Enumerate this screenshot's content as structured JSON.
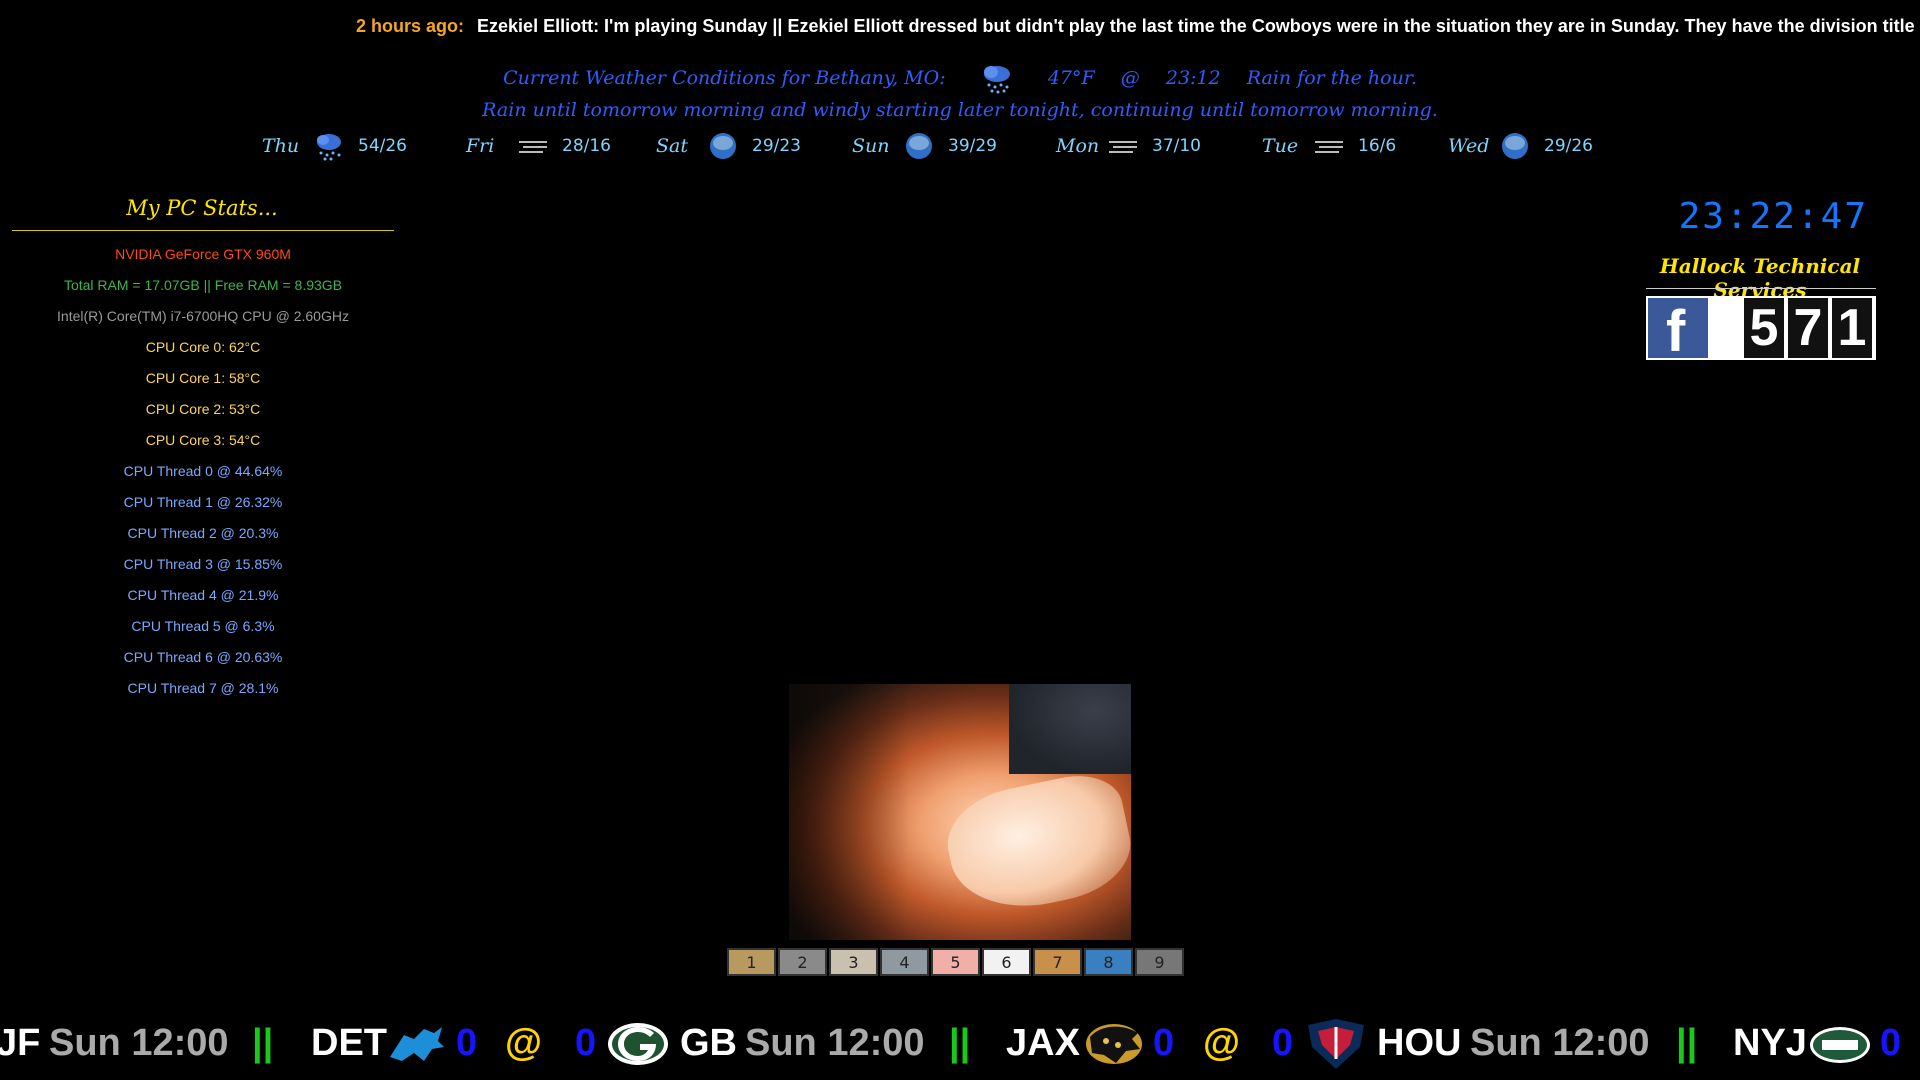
{
  "news": {
    "time": "2 hours ago:",
    "text": "Ezekiel Elliott: I'm playing Sunday  ||  Ezekiel Elliott dressed but didn't play the last time the Cowboys were in the situation they are in Sunday. They have the division title clinched and are locked i"
  },
  "weather": {
    "label": "Current Weather Conditions for Bethany, MO:",
    "temp": "47°F",
    "at": "@",
    "time": "23:12",
    "summary_hour": "Rain for the hour.",
    "summary_long": "Rain until tomorrow morning and windy starting later tonight, continuing until tomorrow morning.",
    "forecast": [
      {
        "day": "Thu",
        "temps": "54/26",
        "icon": "rain-cloud-icon"
      },
      {
        "day": "Fri",
        "temps": "28/16",
        "icon": "wind-icon"
      },
      {
        "day": "Sat",
        "temps": "29/23",
        "icon": "cloud-icon"
      },
      {
        "day": "Sun",
        "temps": "39/29",
        "icon": "cloud-icon"
      },
      {
        "day": "Mon",
        "temps": "37/10",
        "icon": "wind-icon"
      },
      {
        "day": "Tue",
        "temps": "16/6",
        "icon": "wind-icon"
      },
      {
        "day": "Wed",
        "temps": "29/26",
        "icon": "cloud-icon"
      }
    ]
  },
  "stats": {
    "title": "My PC Stats...",
    "gpu": "NVIDIA GeForce GTX 960M",
    "ram": "Total RAM = 17.07GB  ||  Free RAM = 8.93GB",
    "cpu": "Intel(R) Core(TM) i7-6700HQ CPU @ 2.60GHz",
    "cores": [
      "CPU Core 0:   62°C",
      "CPU Core 1:   58°C",
      "CPU Core 2:   53°C",
      "CPU Core 3:   54°C"
    ],
    "threads": [
      "CPU Thread 0  @  44.64%",
      "CPU Thread 1  @  26.32%",
      "CPU Thread 2  @  20.3%",
      "CPU Thread 3  @  15.85%",
      "CPU Thread 4  @  21.9%",
      "CPU Thread 5  @  6.3%",
      "CPU Thread 6  @  20.63%",
      "CPU Thread 7  @  28.1%"
    ]
  },
  "clock": "23:22:47",
  "company": "Hallock Technical Services",
  "facebook": {
    "logo_letter": "f",
    "digits": [
      "5",
      "7",
      "1"
    ]
  },
  "film_strip": [
    "1",
    "2",
    "3",
    "4",
    "5",
    "6",
    "7",
    "8",
    "9"
  ],
  "film_colors": [
    "#b89a60",
    "#8a8a8a",
    "#c9c0b0",
    "#8f9aa0",
    "#f0b0a8",
    "#f2f2f2",
    "#c8904a",
    "#3a7fc0",
    "#777777"
  ],
  "scores": {
    "frag_team": "JF",
    "time1": "Sun 12:00",
    "sep": "||",
    "g1_home": "DET",
    "g1_home_score": "0",
    "at": "@",
    "g1_away_score": "0",
    "g1_away": "GB",
    "time2": "Sun 12:00",
    "g2_home": "JAX",
    "g2_home_score": "0",
    "g2_away_score": "0",
    "g2_away": "HOU",
    "time3": "Sun 12:00",
    "g3_home": "NYJ",
    "g3_home_score": "0",
    "logos": {
      "det": "lions-logo-icon",
      "gb": "packers-logo-icon",
      "jax": "jaguars-logo-icon",
      "hou": "texans-logo-icon",
      "nyj": "jets-logo-icon"
    }
  }
}
